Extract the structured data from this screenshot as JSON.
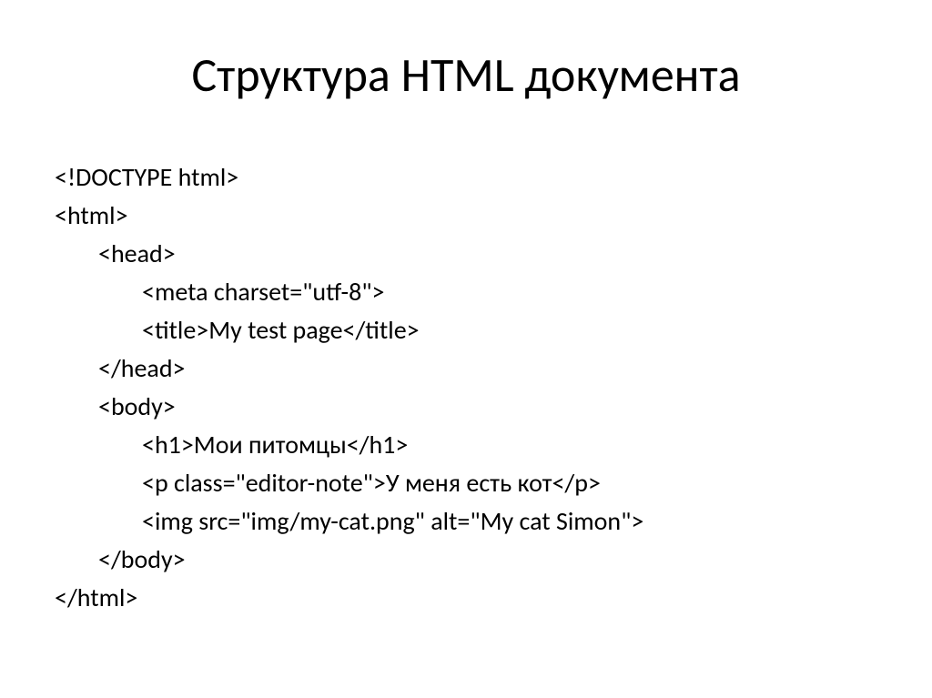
{
  "title": "Структура HTML документа",
  "code": {
    "line1": "<!DOCTYPE html>",
    "line2": "<html>",
    "line3": "<head>",
    "line4": "<meta charset=\"utf-8\">",
    "line5": "<title>My test page</title>",
    "line6": "</head>",
    "line7": "<body>",
    "line8": "<h1>Мои питомцы</h1>",
    "line9": "<p class=\"editor-note\">У меня есть кот</p>",
    "line10": "<img src=\"img/my-cat.png\" alt=\"My cat Simon\">",
    "line11": "</body>",
    "line12": "</html>"
  }
}
